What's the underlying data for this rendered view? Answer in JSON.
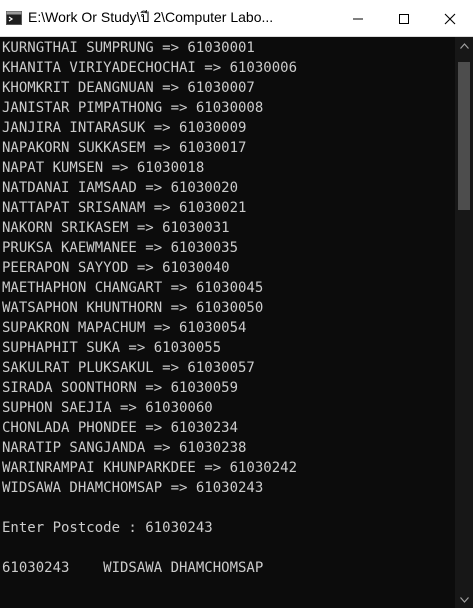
{
  "window": {
    "title": "E:\\Work Or Study\\ปี 2\\Computer Labo..."
  },
  "icons": {
    "app": "terminal-app-icon",
    "minimize": "minimize-icon",
    "maximize": "maximize-icon",
    "close": "close-icon",
    "scroll_up": "chevron-up-icon",
    "scroll_down": "chevron-down-icon"
  },
  "console": {
    "entries": [
      "KURNGTHAI SUMPRUNG => 61030001",
      "KHANITA VIRIYADECHOCHAI => 61030006",
      "KHOMKRIT DEANGNUAN => 61030007",
      "JANISTAR PIMPATHONG => 61030008",
      "JANJIRA INTARASUK => 61030009",
      "NAPAKORN SUKKASEM => 61030017",
      "NAPAT KUMSEN => 61030018",
      "NATDANAI IAMSAAD => 61030020",
      "NATTAPAT SRISANAM => 61030021",
      "NAKORN SRIKASEM => 61030031",
      "PRUKSA KAEWMANEE => 61030035",
      "PEERAPON SAYYOD => 61030040",
      "MAETHAPHON CHANGART => 61030045",
      "WATSAPHON KHUNTHORN => 61030050",
      "SUPAKRON MAPACHUM => 61030054",
      "SUPHAPHIT SUKA => 61030055",
      "SAKULRAT PLUKSAKUL => 61030057",
      "SIRADA SOONTHORN => 61030059",
      "SUPHON SAEJIA => 61030060",
      "CHONLADA PHONDEE => 61030234",
      "NARATIP SANGJANDA => 61030238",
      "WARINRAMPAI KHUNPARKDEE => 61030242",
      "WIDSAWA DHAMCHOMSAP => 61030243"
    ],
    "prompt": "Enter Postcode : 61030243",
    "result": "61030243    WIDSAWA DHAMCHOMSAP"
  }
}
